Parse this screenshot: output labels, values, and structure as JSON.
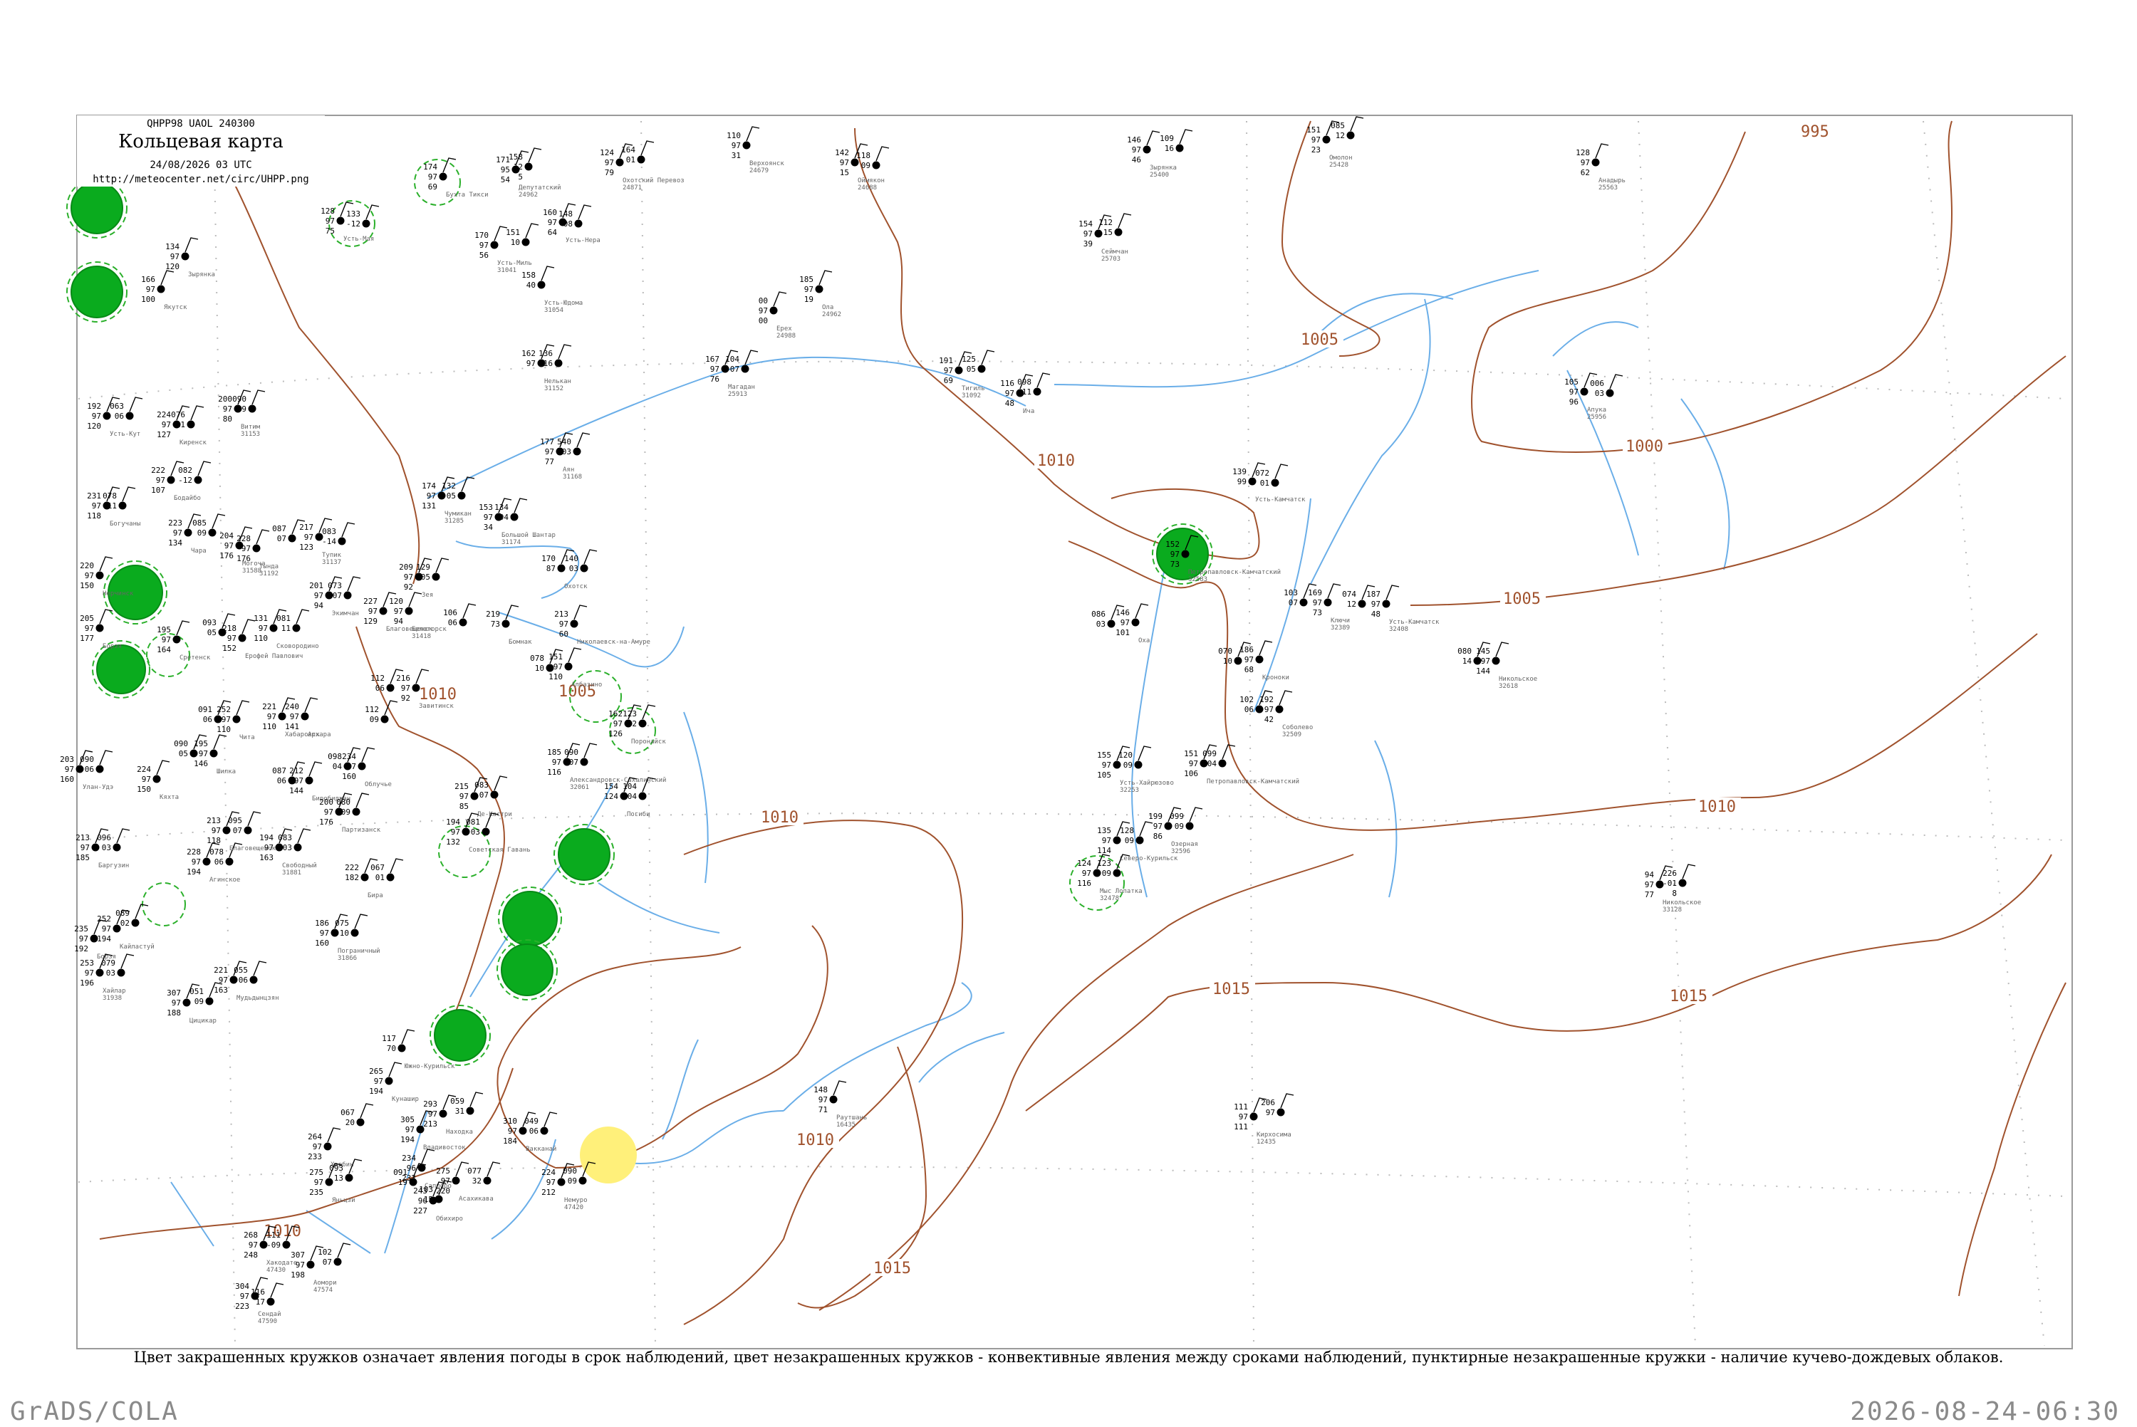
{
  "header": {
    "code": "QHPP98  UAOL  240300",
    "title": "Кольцевая карта",
    "datetime": "24/08/2026 03 UTC",
    "url": "http://meteocenter.net/circ/UHPP.png"
  },
  "caption": "Цвет закрашенных кружков означает явления погоды в срок наблюдений, цвет незакрашенных кружков - конвективные явления между сроками наблюдений, пунктирные незакрашенные кружки - наличие кучево-дождевых облаков.",
  "footer": {
    "left": "GrADS/COLA",
    "right": "2026-08-24-06:30"
  },
  "colors": {
    "isobar": "#a0522d",
    "water": "#6aaee8",
    "frame": "#9a9a9a",
    "filled_circle": "#0aab1e",
    "yellow_circle": "#fff07a",
    "dashed_circle": "#2bb02b",
    "station_text": "#000000",
    "station_name": "#666666"
  },
  "isobars": [
    {
      "label": "995"
    },
    {
      "label": "1000"
    },
    {
      "label": "1005"
    },
    {
      "label": "1005"
    },
    {
      "label": "1005"
    },
    {
      "label": "1010"
    },
    {
      "label": "1010"
    },
    {
      "label": "1010"
    },
    {
      "label": "1010"
    },
    {
      "label": "1010"
    },
    {
      "label": "1010"
    },
    {
      "label": "1015"
    },
    {
      "label": "1015"
    },
    {
      "label": "1015"
    }
  ],
  "stations": [
    {
      "p": "174",
      "t": "97",
      "d": "69",
      "name": "Бухта Тикси"
    },
    {
      "p": "171",
      "t": "95",
      "d": "54",
      "name": "Депутатский",
      "id": "24962"
    },
    {
      "p": "158",
      "t": "12",
      "d": "5"
    },
    {
      "p": "124",
      "t": "97",
      "d": "79",
      "name": "Охотский Перевоз",
      "id": "24871"
    },
    {
      "p": "164",
      "t": "01"
    },
    {
      "p": "110",
      "t": "97",
      "d": "31",
      "name": "Верхоянск",
      "id": "24679"
    },
    {
      "p": "142",
      "t": "97",
      "d": "15",
      "name": "Оймякон",
      "id": "24688"
    },
    {
      "p": "118",
      "t": "09"
    },
    {
      "p": "146",
      "t": "97",
      "d": "46",
      "name": "Зырянка",
      "id": "25400"
    },
    {
      "p": "109",
      "t": "16"
    },
    {
      "p": "151",
      "t": "97",
      "d": "23",
      "name": "Омолон",
      "id": "25428"
    },
    {
      "p": "085",
      "t": "12"
    },
    {
      "p": "128",
      "t": "97",
      "d": "62",
      "name": "Анадырь",
      "id": "25563"
    },
    {
      "p": "128",
      "t": "97",
      "d": "75",
      "name": "Усть-Мая"
    },
    {
      "p": "133",
      "t": "-12"
    },
    {
      "p": "160",
      "t": "97",
      "d": "64",
      "name": "Усть-Нера"
    },
    {
      "p": "148",
      "t": "-08"
    },
    {
      "p": "170",
      "t": "97",
      "d": "56",
      "name": "Усть-Миль",
      "id": "31041"
    },
    {
      "p": "151",
      "t": "10"
    },
    {
      "p": "154",
      "t": "97",
      "d": "39",
      "name": "Сеймчан",
      "id": "25703"
    },
    {
      "p": "112",
      "t": "15"
    },
    {
      "p": "134",
      "t": "97",
      "d": "120",
      "name": "Зырянка"
    },
    {
      "p": "166",
      "t": "97",
      "d": "100",
      "name": "Якутск"
    },
    {
      "p": "158",
      "t": "40",
      "name": "Усть-Юдома",
      "id": "31054"
    },
    {
      "p": "185",
      "t": "97",
      "d": "19",
      "name": "Ола",
      "id": "24962"
    },
    {
      "p": "00",
      "t": "97",
      "d": "00",
      "name": "Ерех",
      "id": "24988"
    },
    {
      "p": "167",
      "t": "97",
      "d": "76",
      "name": "Магадан",
      "id": "25913"
    },
    {
      "p": "104",
      "t": "07"
    },
    {
      "p": "191",
      "t": "97",
      "d": "69",
      "name": "Тигиль",
      "id": "31092"
    },
    {
      "p": "125",
      "t": "05"
    },
    {
      "p": "116",
      "t": "97",
      "d": "48",
      "name": "Ича"
    },
    {
      "p": "098",
      "t": "11"
    },
    {
      "p": "105",
      "t": "97",
      "d": "96",
      "name": "Апука",
      "id": "25956"
    },
    {
      "p": "006",
      "t": "03"
    },
    {
      "p": "162",
      "t": "97",
      "name": "Нелькан",
      "id": "31152"
    },
    {
      "p": "136",
      "t": "16"
    },
    {
      "p": "200",
      "t": "97",
      "d": "80",
      "name": "Витим",
      "id": "31153"
    },
    {
      "p": "090",
      "t": "09"
    },
    {
      "p": "192",
      "t": "97",
      "d": "120",
      "name": "Усть-Кут"
    },
    {
      "p": "063",
      "t": "06"
    },
    {
      "p": "224",
      "t": "97",
      "d": "127",
      "name": "Киренск"
    },
    {
      "p": "076",
      "t": "11"
    },
    {
      "p": "177",
      "t": "97",
      "d": "77",
      "name": "Аян",
      "id": "31168"
    },
    {
      "p": "540",
      "t": "03"
    },
    {
      "p": "174",
      "t": "97",
      "d": "131",
      "name": "Чумикан",
      "id": "31285"
    },
    {
      "p": "132",
      "t": "05"
    },
    {
      "p": "153",
      "t": "97",
      "d": "34",
      "name": "Большой Шантар",
      "id": "31174"
    },
    {
      "p": "134",
      "t": "04"
    },
    {
      "p": "139",
      "t": "99",
      "name": "Усть-Камчатск"
    },
    {
      "p": "072",
      "t": "01"
    },
    {
      "p": "222",
      "t": "97",
      "d": "107",
      "name": "Бодайбо"
    },
    {
      "p": "082",
      "t": "-12"
    },
    {
      "p": "231",
      "t": "97",
      "d": "118",
      "name": "Богучаны"
    },
    {
      "p": "078",
      "t": "11"
    },
    {
      "p": "223",
      "t": "97",
      "d": "134",
      "name": "Чара"
    },
    {
      "p": "085",
      "t": "09"
    },
    {
      "p": "204",
      "t": "97",
      "d": "176",
      "name": "Могоча",
      "id": "31588"
    },
    {
      "p": "228",
      "t": "97",
      "d": "176",
      "name": "Тында",
      "id": "31192"
    },
    {
      "p": "087",
      "t": "07"
    },
    {
      "p": "217",
      "t": "97",
      "d": "123",
      "name": "Тупик",
      "id": "31137"
    },
    {
      "p": "083",
      "t": "-14"
    },
    {
      "p": "170",
      "t": "87",
      "name": "Охотск"
    },
    {
      "p": "140",
      "t": "03"
    },
    {
      "p": "152",
      "t": "97",
      "d": "73",
      "name": "Петропавловск-Камчатский",
      "id": "32583"
    },
    {
      "p": "209",
      "t": "97",
      "d": "92",
      "name": "Зея"
    },
    {
      "p": "129",
      "t": "05"
    },
    {
      "p": "201",
      "t": "97",
      "d": "94",
      "name": "Экимчан"
    },
    {
      "p": "073",
      "t": "07"
    },
    {
      "p": "220",
      "t": "97",
      "d": "150",
      "name": "Нерчинск"
    },
    {
      "p": "205",
      "t": "97",
      "d": "177",
      "name": "Борзя"
    },
    {
      "p": "195",
      "t": "97",
      "d": "164",
      "name": "Сретенск"
    },
    {
      "p": "093",
      "t": "05"
    },
    {
      "p": "218",
      "t": "97",
      "d": "152",
      "name": "Ерофей Павлович"
    },
    {
      "p": "131",
      "t": "97",
      "d": "110",
      "name": "Сковородино"
    },
    {
      "p": "081",
      "t": "11"
    },
    {
      "p": "227",
      "t": "97",
      "d": "129",
      "name": "Благовещенск"
    },
    {
      "p": "120",
      "t": "97",
      "d": "94",
      "name": "Белогорск",
      "id": "31418"
    },
    {
      "p": "106",
      "t": "06"
    },
    {
      "p": "219",
      "t": "73",
      "name": "Бомнак"
    },
    {
      "p": "213",
      "t": "97",
      "d": "60",
      "name": "Николаевск-на-Амуре"
    },
    {
      "p": "103",
      "t": "07"
    },
    {
      "p": "169",
      "t": "97",
      "d": "73",
      "name": "Ключи",
      "id": "32389"
    },
    {
      "p": "074",
      "t": "12"
    },
    {
      "p": "187",
      "t": "97",
      "d": "48",
      "name": "Усть-Камчатск",
      "id": "32408"
    },
    {
      "p": "070",
      "t": "10"
    },
    {
      "p": "186",
      "t": "97",
      "d": "68",
      "name": "Кроноки"
    },
    {
      "p": "080",
      "t": "14"
    },
    {
      "p": "145",
      "t": "97",
      "d": "144",
      "name": "Никольское",
      "id": "32618"
    },
    {
      "p": "086",
      "t": "03"
    },
    {
      "p": "146",
      "t": "97",
      "d": "101",
      "name": "Оха"
    },
    {
      "p": "102",
      "t": "06"
    },
    {
      "p": "192",
      "t": "97",
      "d": "42",
      "name": "Соболево",
      "id": "32509"
    },
    {
      "p": "078",
      "t": "10"
    },
    {
      "p": "151",
      "t": "97",
      "d": "110",
      "name": "Албазино"
    },
    {
      "p": "112",
      "t": "06"
    },
    {
      "p": "216",
      "t": "97",
      "d": "92",
      "name": "Завитинск"
    },
    {
      "p": "112",
      "t": "09"
    },
    {
      "p": "221",
      "t": "97",
      "d": "110",
      "name": "Хабаровск"
    },
    {
      "p": "240",
      "t": "97",
      "d": "141",
      "name": "Архара"
    },
    {
      "p": "091",
      "t": "06"
    },
    {
      "p": "252",
      "t": "97",
      "d": "110",
      "name": "Чита"
    },
    {
      "p": "090",
      "t": "05"
    },
    {
      "p": "195",
      "t": "97",
      "d": "146",
      "name": "Шилка"
    },
    {
      "p": "098",
      "t": "04"
    },
    {
      "p": "234",
      "t": "97",
      "d": "160",
      "name": "Облучье"
    },
    {
      "p": "087",
      "t": "06"
    },
    {
      "p": "212",
      "t": "97",
      "d": "144",
      "name": "Биробиджан"
    },
    {
      "p": "200",
      "t": "97",
      "d": "176",
      "name": "Партизанск"
    },
    {
      "p": "080",
      "t": "09"
    },
    {
      "p": "185",
      "t": "97",
      "d": "116",
      "name": "Александровск-Сахалинский",
      "id": "32061"
    },
    {
      "p": "090",
      "t": "07"
    },
    {
      "p": "162",
      "t": "97",
      "d": "126",
      "name": "Поронайск"
    },
    {
      "p": "123",
      "t": "02"
    },
    {
      "p": "215",
      "t": "97",
      "d": "85",
      "name": "Де-Кастри"
    },
    {
      "p": "083",
      "t": "07"
    },
    {
      "p": "194",
      "t": "97",
      "d": "132",
      "name": "Советская Гавань"
    },
    {
      "p": "081",
      "t": "03"
    },
    {
      "p": "154",
      "t": "124",
      "name": "Погиби"
    },
    {
      "p": "104",
      "t": "04"
    },
    {
      "p": "155",
      "t": "97",
      "d": "105",
      "name": "Усть-Хайрюзово",
      "id": "32253"
    },
    {
      "p": "120",
      "t": "09"
    },
    {
      "p": "151",
      "t": "97",
      "d": "106",
      "name": "Петропавловск-Камчатский"
    },
    {
      "p": "099",
      "t": "04"
    },
    {
      "p": "199",
      "t": "97",
      "d": "86",
      "name": "Озерная",
      "id": "32596"
    },
    {
      "p": "099",
      "t": "09"
    },
    {
      "p": "135",
      "t": "97",
      "d": "114",
      "name": "Северо-Курильск"
    },
    {
      "p": "128",
      "t": "09"
    },
    {
      "p": "124",
      "t": "97",
      "d": "116",
      "name": "Мыс Лопатка",
      "id": "32478"
    },
    {
      "p": "123",
      "t": "09"
    },
    {
      "p": "203",
      "t": "97",
      "d": "160",
      "name": "Улан-Удэ"
    },
    {
      "p": "090",
      "t": "06"
    },
    {
      "p": "224",
      "t": "97",
      "d": "150",
      "name": "Кяхта"
    },
    {
      "p": "213",
      "t": "97",
      "d": "185",
      "name": "Баргузин"
    },
    {
      "p": "096",
      "t": "03"
    },
    {
      "p": "228",
      "t": "97",
      "d": "194",
      "name": "Агинское"
    },
    {
      "p": "078",
      "t": "06"
    },
    {
      "p": "213",
      "t": "97",
      "d": "118",
      "name": "Благовещенск"
    },
    {
      "p": "095",
      "t": "07"
    },
    {
      "p": "194",
      "t": "97",
      "d": "163",
      "name": "Свободный",
      "id": "31881"
    },
    {
      "p": "083",
      "t": "03"
    },
    {
      "p": "222",
      "t": "182",
      "name": "Бира"
    },
    {
      "p": "067",
      "t": "01"
    },
    {
      "p": "186",
      "t": "97",
      "d": "160",
      "name": "Пограничный",
      "id": "31866"
    },
    {
      "p": "075",
      "t": "10"
    },
    {
      "p": "235",
      "t": "97",
      "d": "192",
      "name": "Борзя"
    },
    {
      "p": "252",
      "t": "97",
      "d": "194",
      "name": "Кайластуй"
    },
    {
      "p": "089",
      "t": "02"
    },
    {
      "p": "253",
      "t": "97",
      "d": "196",
      "name": "Хайлар",
      "id": "31938"
    },
    {
      "p": "079",
      "t": "03"
    },
    {
      "p": "221",
      "t": "97",
      "d": "163",
      "name": "Мудьдынцзян"
    },
    {
      "p": "055",
      "t": "06"
    },
    {
      "p": "307",
      "t": "97",
      "d": "188",
      "name": "Цицикар"
    },
    {
      "p": "051",
      "t": "09"
    },
    {
      "p": "117",
      "t": "70",
      "name": "Южно-Курильск"
    },
    {
      "p": "265",
      "t": "97",
      "d": "194",
      "name": "Кунашир"
    },
    {
      "p": "305",
      "t": "97",
      "d": "194",
      "name": "Владивосток"
    },
    {
      "p": "067",
      "t": "20"
    },
    {
      "p": "293",
      "t": "97",
      "d": "213",
      "name": "Находка"
    },
    {
      "p": "059",
      "t": "31"
    },
    {
      "p": "264",
      "t": "97",
      "d": "233",
      "name": "Харбин"
    },
    {
      "p": "275",
      "t": "97",
      "d": "235",
      "name": "Яньцзи"
    },
    {
      "p": "093",
      "t": "13"
    },
    {
      "p": "234",
      "t": "96",
      "d": "232",
      "name": "Саппоро"
    },
    {
      "p": "091",
      "t": "19"
    },
    {
      "p": "275",
      "t": "97",
      "d": "220",
      "name": "Асахикава"
    },
    {
      "p": "077",
      "t": "32"
    },
    {
      "p": "310",
      "t": "97",
      "d": "184",
      "name": "Вакканай"
    },
    {
      "p": "049",
      "t": "06"
    },
    {
      "p": "224",
      "t": "97",
      "d": "212",
      "name": "Немуро",
      "id": "47420"
    },
    {
      "p": "090",
      "t": "09"
    },
    {
      "p": "243",
      "t": "96",
      "d": "227",
      "name": "Обихиро"
    },
    {
      "p": "103",
      "t": "15"
    },
    {
      "p": "268",
      "t": "97",
      "d": "248",
      "name": "Хакодате",
      "id": "47430"
    },
    {
      "p": "111",
      "t": "-09"
    },
    {
      "p": "307",
      "t": "97",
      "d": "198",
      "name": "Аомори",
      "id": "47574"
    },
    {
      "p": "102",
      "t": "07"
    },
    {
      "p": "304",
      "t": "97",
      "d": "223",
      "name": "Сендай",
      "id": "47590"
    },
    {
      "p": "116",
      "t": "17"
    },
    {
      "p": "148",
      "t": "97",
      "d": "71",
      "name": "Раутшань",
      "id": "16435"
    },
    {
      "p": "111",
      "t": "97",
      "d": "111",
      "name": "Кирхосима",
      "id": "12435"
    },
    {
      "p": "206",
      "t": "97"
    },
    {
      "p": "94",
      "t": "97",
      "d": "77",
      "name": "Никольское",
      "id": "33128"
    },
    {
      "p": "226",
      "t": "-01",
      "d": "8"
    }
  ]
}
